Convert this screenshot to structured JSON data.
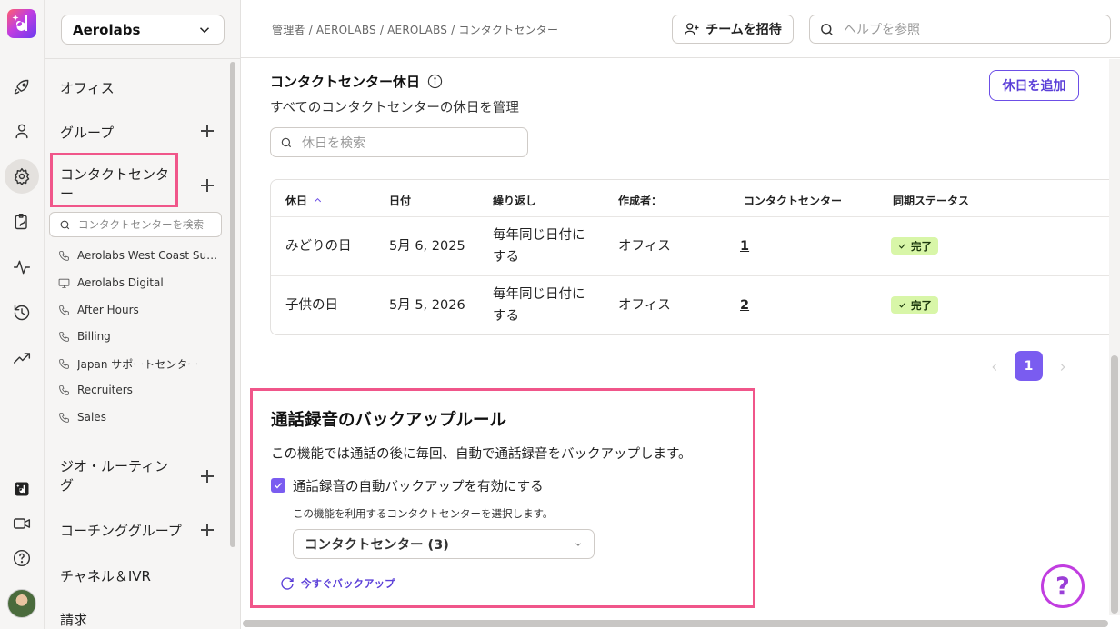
{
  "org": {
    "name": "Aerolabs"
  },
  "breadcrumb": "管理者 / AEROLABS / AEROLABS / コンタクトセンター",
  "header": {
    "invite_label": "チームを招待",
    "help_placeholder": "ヘルプを参照"
  },
  "nav": {
    "items": [
      {
        "label": "オフィス",
        "has_add": false
      },
      {
        "label": "グループ",
        "has_add": true
      },
      {
        "label": "コンタクトセンター",
        "has_add": true,
        "selected": true
      },
      {
        "label": "ジオ・ルーティング",
        "has_add": true
      },
      {
        "label": "コーチンググループ",
        "has_add": true
      },
      {
        "label": "チャネル＆IVR",
        "has_add": false
      },
      {
        "label": "請求",
        "has_add": false
      }
    ],
    "cc_search_placeholder": "コンタクトセンターを検索",
    "contact_centers": [
      {
        "label": "Aerolabs West Coast Supp...",
        "icon": "phone-icon"
      },
      {
        "label": "Aerolabs Digital",
        "icon": "monitor-icon"
      },
      {
        "label": "After Hours",
        "icon": "phone-icon"
      },
      {
        "label": "Billing",
        "icon": "phone-icon"
      },
      {
        "label": "Japan サポートセンター",
        "icon": "phone-icon"
      },
      {
        "label": "Recruiters",
        "icon": "phone-icon"
      },
      {
        "label": "Sales",
        "icon": "phone-icon"
      }
    ]
  },
  "holidays": {
    "title": "コンタクトセンター休日",
    "subtitle": "すべてのコンタクトセンターの休日を管理",
    "add_label": "休日を追加",
    "search_placeholder": "休日を検索",
    "columns": [
      "休日",
      "日付",
      "繰り返し",
      "作成者：",
      "コンタクトセンター",
      "同期ステータス"
    ],
    "rows": [
      {
        "name": "みどりの日",
        "date": "5月 6, 2025",
        "repeat_1": "毎年同じ日付に",
        "repeat_2": "する",
        "creator": "オフィス",
        "centers": "1",
        "status": "完了"
      },
      {
        "name": "子供の日",
        "date": "5月 5, 2026",
        "repeat_1": "毎年同じ日付に",
        "repeat_2": "する",
        "creator": "オフィス",
        "centers": "2",
        "status": "完了"
      }
    ],
    "current_page": "1"
  },
  "backup": {
    "title": "通話録音のバックアップルール",
    "description": "この機能では通話の後に毎回、自動で通話録音をバックアップします。",
    "checkbox_label": "通話録音の自動バックアップを有効にする",
    "checkbox_checked": true,
    "select_label": "この機能を利用するコンタクトセンターを選択します。",
    "select_value": "コンタクトセンター (3)",
    "backup_now_label": "今すぐバックアップ"
  },
  "colors": {
    "accent": "#7a5cf0",
    "highlight": "#f0568a",
    "success_bg": "#d8f6a8"
  }
}
